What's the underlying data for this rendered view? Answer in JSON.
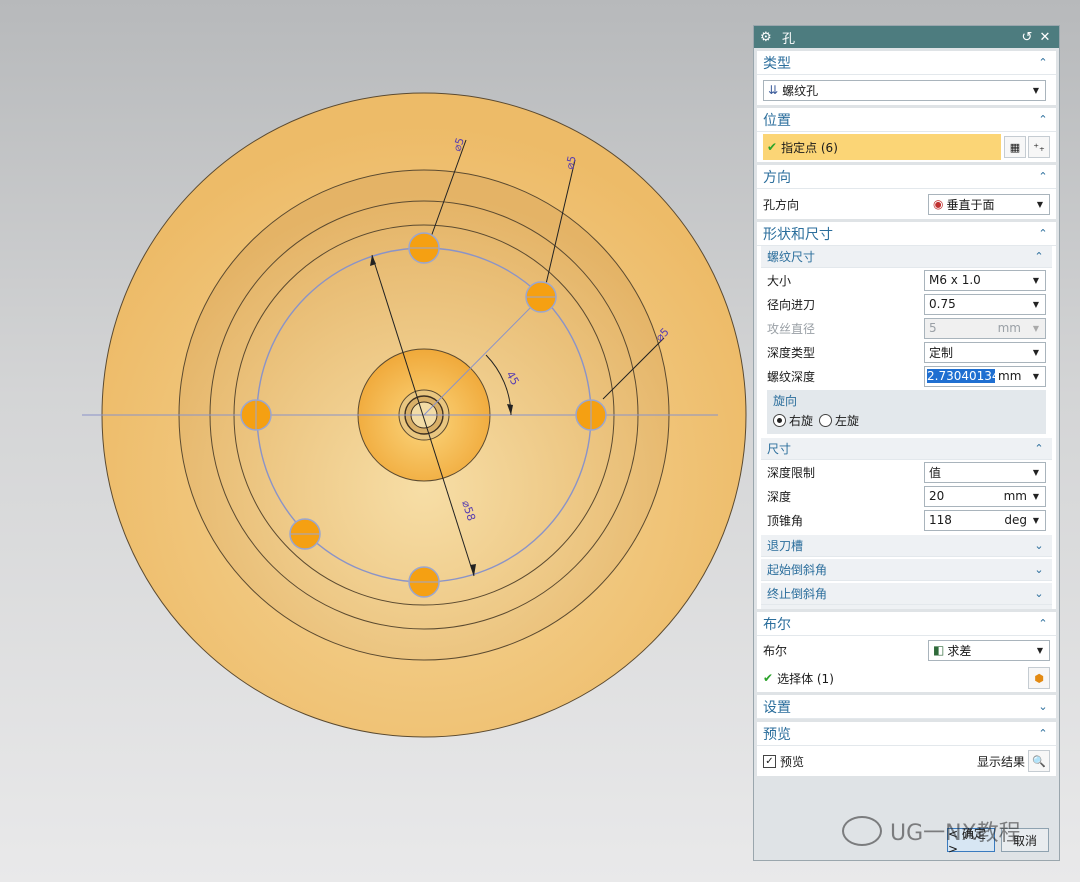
{
  "dialog": {
    "title": "孔",
    "icons": {
      "settings": "gear-icon",
      "reset": "reset-icon",
      "close": "close-icon"
    }
  },
  "type_group": {
    "header": "类型",
    "selected": "螺纹孔"
  },
  "position_group": {
    "header": "位置",
    "specify_point": "指定点 (6)"
  },
  "direction_group": {
    "header": "方向",
    "hole_dir_label": "孔方向",
    "hole_dir_value": "垂直于面"
  },
  "shape_group": {
    "header": "形状和尺寸",
    "thread": {
      "header": "螺纹尺寸",
      "size_label": "大小",
      "size_value": "M6 x 1.0",
      "radial_label": "径向进刀",
      "radial_value": "0.75",
      "tap_label": "攻丝直径",
      "tap_value": "5",
      "tap_unit": "mm",
      "depth_type_label": "深度类型",
      "depth_type_value": "定制",
      "thread_depth_label": "螺纹深度",
      "thread_depth_value": "2.73040134",
      "thread_depth_unit": "mm",
      "rotation_header": "旋向",
      "right": "右旋",
      "left": "左旋"
    },
    "dims": {
      "header": "尺寸",
      "limit_label": "深度限制",
      "limit_value": "值",
      "depth_label": "深度",
      "depth_value": "20",
      "depth_unit": "mm",
      "tip_label": "顶锥角",
      "tip_value": "118",
      "tip_unit": "deg"
    },
    "relief": "退刀槽",
    "start_chamfer": "起始倒斜角",
    "end_chamfer": "终止倒斜角"
  },
  "boolean_group": {
    "header": "布尔",
    "label": "布尔",
    "value": "求差",
    "select_body": "选择体 (1)"
  },
  "settings_group": {
    "header": "设置"
  },
  "preview_group": {
    "header": "预览",
    "preview_label": "预览",
    "show_result": "显示结果"
  },
  "buttons": {
    "ok": "< 确定 >",
    "cancel": "取消"
  },
  "viewport": {
    "dims": [
      "⌀5",
      "⌀5",
      "⌀5",
      "⌀58",
      "45"
    ]
  },
  "watermark": "UG一NX教程",
  "colors": {
    "title_bar": "#4d7c7f",
    "header_text": "#2b6e9c",
    "highlight": "#fbd576",
    "part_face": "#f2c273",
    "hole": "#f5a012"
  }
}
